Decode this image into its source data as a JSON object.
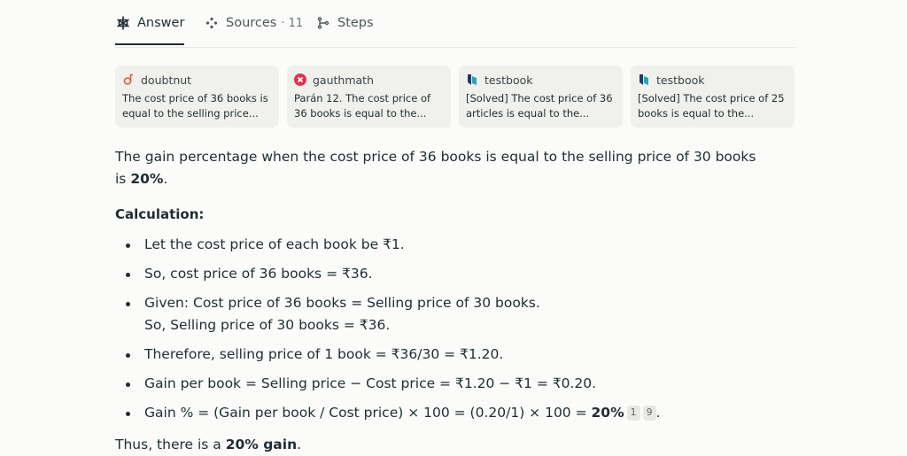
{
  "tabs": [
    {
      "label": "Answer",
      "icon": "answer-icon"
    },
    {
      "label": "Sources",
      "count": "· 11",
      "icon": "sources-icon"
    },
    {
      "label": "Steps",
      "icon": "steps-icon"
    }
  ],
  "sources": [
    {
      "site": "doubtnut",
      "title": "The cost price of 36 books is equal to the selling price...",
      "icon": "doubtnut-icon",
      "color": "#e4573d"
    },
    {
      "site": "gauthmath",
      "title": "Parán 12. The cost price of 36 books is equal to the...",
      "icon": "gauthmath-icon",
      "color": "#e0334f"
    },
    {
      "site": "testbook",
      "title": "[Solved] The cost price of 36 articles is equal to the...",
      "icon": "testbook-icon",
      "color": "#1b3f6b"
    },
    {
      "site": "testbook",
      "title": "[Solved] The cost price of 25 books is equal to the...",
      "icon": "testbook-icon",
      "color": "#1b3f6b"
    }
  ],
  "answer": {
    "intro": "The gain percentage when the cost price of 36 books is equal to the selling price of 30 books is ",
    "result": "20%",
    "intro_end": ".",
    "calc_heading": "Calculation:",
    "steps": [
      {
        "text": "Let the cost price of each book be ₹1."
      },
      {
        "text": "So, cost price of 36 books = ₹36."
      },
      {
        "text": "Given: Cost price of 36 books = Selling price of 30 books.",
        "line2": "So, Selling price of 30 books = ₹36."
      },
      {
        "text": "Therefore, selling price of 1 book = ₹36/30 = ₹1.20."
      },
      {
        "text": "Gain per book = Selling price − Cost price = ₹1.20 − ₹1 = ₹0.20."
      },
      {
        "text": "Gain % = (Gain per book / Cost price) × 100 = (0.20/1) × 100 = ",
        "bold": "20%",
        "citations": [
          "1",
          "9"
        ],
        "end": "."
      }
    ],
    "conclusion_pre": "Thus, there is a ",
    "conclusion_bold": "20% gain",
    "conclusion_end": "."
  }
}
